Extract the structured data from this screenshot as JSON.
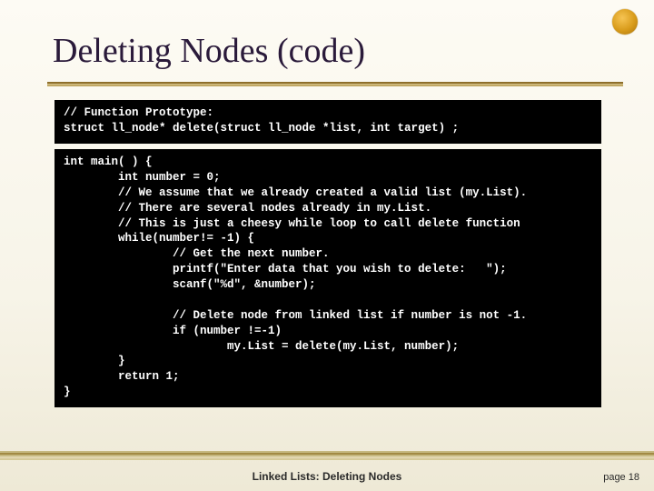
{
  "title": "Deleting Nodes (code)",
  "code_block1": "// Function Prototype:\nstruct ll_node* delete(struct ll_node *list, int target) ;",
  "code_block2": "int main( ) {\n        int number = 0;\n        // We assume that we already created a valid list (my.List).\n        // There are several nodes already in my.List.\n        // This is just a cheesy while loop to call delete function\n        while(number!= -1) {\n                // Get the next number.\n                printf(\"Enter data that you wish to delete:   \");\n                scanf(\"%d\", &number);\n\n                // Delete node from linked list if number is not -1.\n                if (number !=-1)\n                        my.List = delete(my.List, number);\n        }\n        return 1;\n}",
  "footer": {
    "center": "Linked Lists: Deleting Nodes",
    "page_label": "page",
    "page_number": "18"
  }
}
